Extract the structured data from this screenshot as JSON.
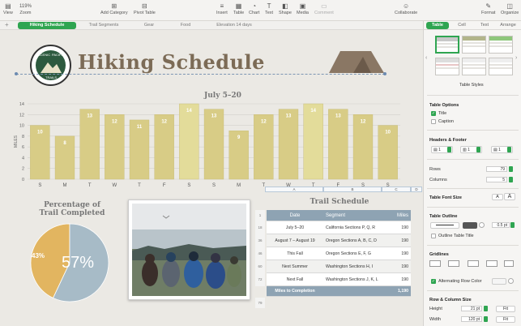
{
  "toolbar": {
    "view": "View",
    "zoom_value": "119%",
    "zoom": "Zoom",
    "add_category": "Add Category",
    "pivot_table": "Pivot Table",
    "insert": "Insert",
    "table": "Table",
    "chart": "Chart",
    "text": "Text",
    "shape": "Shape",
    "media": "Media",
    "comment": "Comment",
    "collaborate": "Collaborate",
    "format": "Format",
    "organize": "Organize"
  },
  "sheets": [
    "Hiking Schedule",
    "Trail Segments",
    "Gear",
    "Food",
    "Elevation 14 days"
  ],
  "inspector": {
    "tabs": [
      "Table",
      "Cell",
      "Text",
      "Arrange"
    ],
    "table_styles": "Table Styles",
    "table_options": "Table Options",
    "title_label": "Title",
    "caption_label": "Caption",
    "headers_footer": "Headers & Footer",
    "header_rows": "1",
    "header_cols": "1",
    "footer_rows": "1",
    "rows_label": "Rows",
    "rows_value": "79",
    "columns_label": "Columns",
    "columns_value": "5",
    "table_font_size": "Table Font Size",
    "font_small": "A",
    "font_big": "A",
    "table_outline": "Table Outline",
    "outline_width": "0.5 pt",
    "outline_table_title": "Outline Table Title",
    "gridlines": "Gridlines",
    "alternating_row_color": "Alternating Row Color",
    "row_column_size": "Row & Column Size",
    "height_label": "Height",
    "height_value": "21 pt",
    "width_label": "Width",
    "width_value": "120 pt",
    "fit": "Fit"
  },
  "canvas": {
    "logo_top": "SCENIC",
    "logo_right": "PACIFIC",
    "logo_bottom": "TRAILS",
    "title": "Hiking Schedule",
    "chart_title": "July 5–20",
    "pie_title_line1": "Percentage of",
    "pie_title_line2": "Trail Completed",
    "pie_small_label": "43%",
    "pie_big_label": "57%",
    "table_title": "Trail Schedule",
    "col_letters": [
      "A",
      "B",
      "C",
      "D"
    ],
    "table_headers": [
      "Date",
      "Segment",
      "Miles"
    ],
    "table_rows": [
      {
        "num": "18",
        "date": "July 5–20",
        "segment": "California Sections P, Q, R",
        "miles": "190"
      },
      {
        "num": "36",
        "date": "August 7 – August 19",
        "segment": "Oregon Sections A, B, C, D",
        "miles": "190"
      },
      {
        "num": "46",
        "date": "This Fall",
        "segment": "Oregon Sections E, F, G",
        "miles": "190"
      },
      {
        "num": "60",
        "date": "Next Summer",
        "segment": "Washington Sections H, I",
        "miles": "190"
      },
      {
        "num": "72",
        "date": "Next Fall",
        "segment": "Washington Sections J, K, L",
        "miles": "190"
      }
    ],
    "footer_label": "Miles to Completion",
    "footer_value": "1,190",
    "row_first": "1",
    "row_last": "79"
  },
  "chart_data": {
    "type": "bar",
    "title": "July 5–20",
    "ylabel": "MILES",
    "categories": [
      "S",
      "M",
      "T",
      "W",
      "T",
      "F",
      "S",
      "S",
      "M",
      "T",
      "W",
      "T",
      "F",
      "S",
      "S"
    ],
    "values": [
      10,
      8,
      13,
      12,
      11,
      12,
      14,
      13,
      9,
      12,
      13,
      14,
      13,
      12,
      10
    ],
    "yticks": [
      0,
      2,
      4,
      6,
      8,
      10,
      12,
      14
    ],
    "ylim": [
      0,
      14
    ],
    "color": "#d8cc86",
    "grid": true
  },
  "pie_data": {
    "type": "pie",
    "values": [
      43,
      57
    ],
    "colors": [
      "#e2b560",
      "#a7bbc7"
    ]
  },
  "colors": {
    "accent": "#2fa551",
    "title": "#7c6b56",
    "table_header": "#8ea3b3"
  }
}
